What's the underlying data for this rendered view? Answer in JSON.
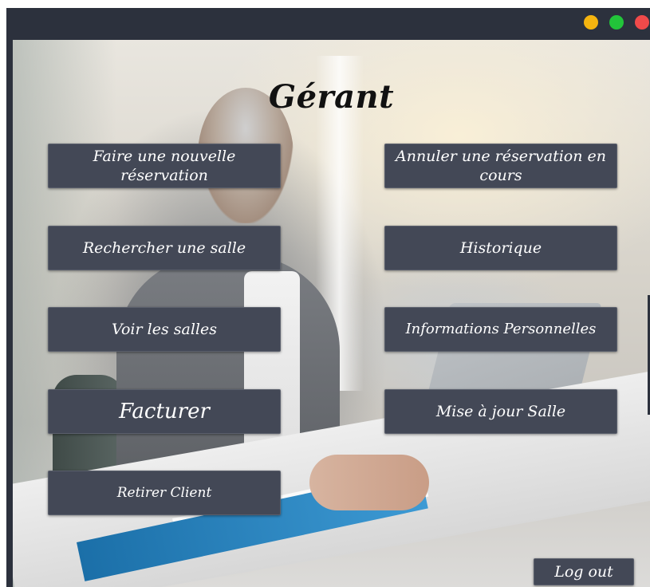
{
  "window": {
    "controls": {
      "minimize_color": "#f5b40f",
      "maximize_color": "#22c43a",
      "close_color": "#f04a4a"
    }
  },
  "page": {
    "title": "Gérant"
  },
  "menu": {
    "new_reservation": "Faire une nouvelle réservation",
    "cancel_reservation": "Annuler une réservation en cours",
    "search_room": "Rechercher une salle",
    "history": "Historique",
    "view_rooms": "Voir les salles",
    "personal_info": "Informations Personnelles",
    "invoice": "Facturer",
    "update_room": "Mise à jour Salle",
    "remove_client": "Retirer Client"
  },
  "footer": {
    "logout": "Log out"
  },
  "colors": {
    "button_bg": "#434856",
    "titlebar_bg": "#2c313d",
    "text": "#ffffff"
  },
  "icons": {
    "background": "office-manager-photo"
  }
}
